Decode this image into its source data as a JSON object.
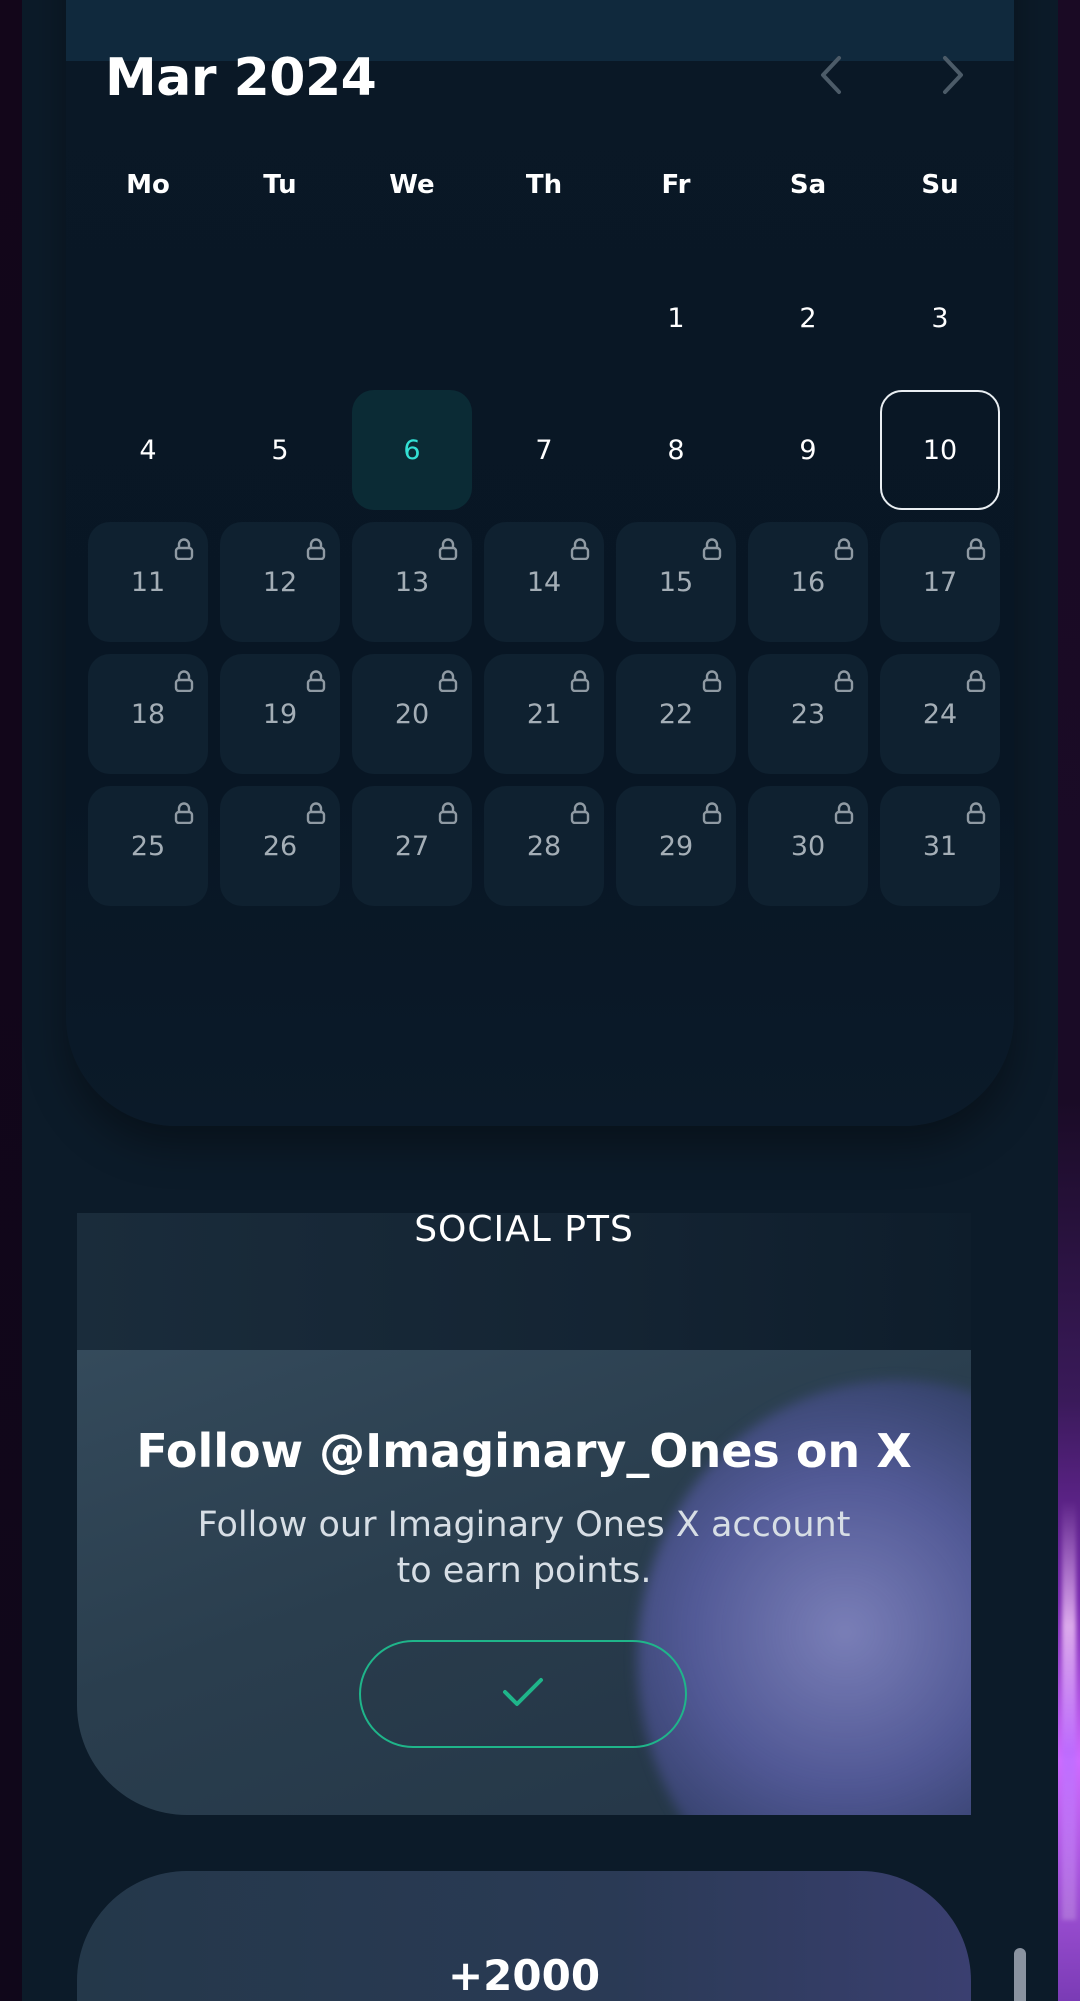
{
  "calendar": {
    "month_title": "Mar 2024",
    "prev_icon": "chevron-left-icon",
    "next_icon": "chevron-right-icon",
    "weekdays": [
      "Mo",
      "Tu",
      "We",
      "Th",
      "Fr",
      "Sa",
      "Su"
    ],
    "today": "6",
    "selected": "10",
    "rows": [
      [
        {
          "label": "",
          "state": "empty"
        },
        {
          "label": "",
          "state": "empty"
        },
        {
          "label": "",
          "state": "empty"
        },
        {
          "label": "",
          "state": "empty"
        },
        {
          "label": "1",
          "state": "normal"
        },
        {
          "label": "2",
          "state": "normal"
        },
        {
          "label": "3",
          "state": "normal"
        }
      ],
      [
        {
          "label": "4",
          "state": "normal"
        },
        {
          "label": "5",
          "state": "normal"
        },
        {
          "label": "6",
          "state": "today"
        },
        {
          "label": "7",
          "state": "normal"
        },
        {
          "label": "8",
          "state": "normal"
        },
        {
          "label": "9",
          "state": "normal"
        },
        {
          "label": "10",
          "state": "selected"
        }
      ],
      [
        {
          "label": "11",
          "state": "locked"
        },
        {
          "label": "12",
          "state": "locked"
        },
        {
          "label": "13",
          "state": "locked"
        },
        {
          "label": "14",
          "state": "locked"
        },
        {
          "label": "15",
          "state": "locked"
        },
        {
          "label": "16",
          "state": "locked"
        },
        {
          "label": "17",
          "state": "locked"
        }
      ],
      [
        {
          "label": "18",
          "state": "locked"
        },
        {
          "label": "19",
          "state": "locked"
        },
        {
          "label": "20",
          "state": "locked"
        },
        {
          "label": "21",
          "state": "locked"
        },
        {
          "label": "22",
          "state": "locked"
        },
        {
          "label": "23",
          "state": "locked"
        },
        {
          "label": "24",
          "state": "locked"
        }
      ],
      [
        {
          "label": "25",
          "state": "locked"
        },
        {
          "label": "26",
          "state": "locked"
        },
        {
          "label": "27",
          "state": "locked"
        },
        {
          "label": "28",
          "state": "locked"
        },
        {
          "label": "29",
          "state": "locked"
        },
        {
          "label": "30",
          "state": "locked"
        },
        {
          "label": "31",
          "state": "locked"
        }
      ]
    ],
    "lock_icon": "lock-icon",
    "colors": {
      "today_text": "#33e0d4",
      "locked_bg": "#0f2130",
      "locked_text": "#a4aeb6"
    }
  },
  "social": {
    "header_title": "SOCIAL PTS",
    "task_title": "Follow @Imaginary_Ones on X",
    "task_description": "Follow our Imaginary Ones X account to earn points.",
    "action_icon": "checkmark-icon",
    "action_color": "#1fb58a"
  },
  "next_task": {
    "points": "+2000"
  }
}
